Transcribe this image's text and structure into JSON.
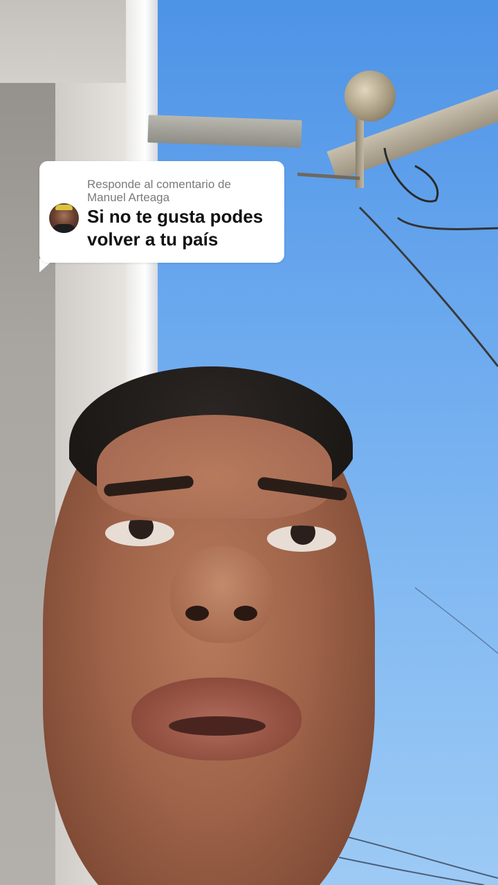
{
  "reply_sticker": {
    "header_line1": "Responde al comentario de",
    "header_line2": "Manuel Arteaga",
    "comment_text": "Si no te gusta podes volver a tu país",
    "avatar": "commenter-avatar",
    "background_color": "#ffffff",
    "header_color": "#7a7a7a",
    "text_color": "#111111"
  },
  "scene": {
    "sky_color": "#6aa8ee"
  }
}
